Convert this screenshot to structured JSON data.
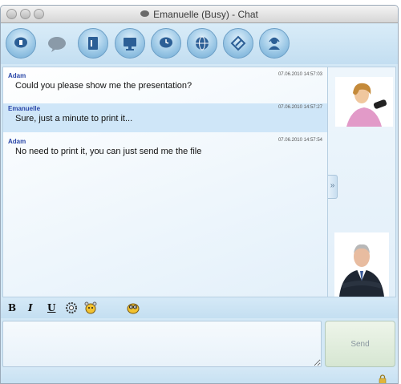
{
  "window": {
    "title": "Emanuelle (Busy) - Chat"
  },
  "toolbar": {
    "buttons": [
      {
        "icon": "chat-bubble-icon"
      },
      {
        "icon": "speech-bubble-icon"
      },
      {
        "icon": "file-send-icon"
      },
      {
        "icon": "screen-share-icon"
      },
      {
        "icon": "history-clock-icon"
      },
      {
        "icon": "globe-icon"
      },
      {
        "icon": "edit-pen-icon"
      },
      {
        "icon": "headset-user-icon"
      }
    ]
  },
  "messages": [
    {
      "sender": "Adam",
      "time": "07.06.2010 14:57:03",
      "text": "Could you please show me the presentation?",
      "highlighted": false
    },
    {
      "sender": "Emanuelle",
      "time": "07.06.2010 14:57:27",
      "text": "Sure, just a minute to print it...",
      "highlighted": true
    },
    {
      "sender": "Adam",
      "time": "07.06.2010 14:57:54",
      "text": "No need to print it, you can just send me the file",
      "highlighted": false
    }
  ],
  "side_panel": {
    "expand_label": "»",
    "contact_avatar": "woman-avatar",
    "user_avatar": "man-avatar"
  },
  "format_bar": {
    "bold_label": "B",
    "italic_label": "I",
    "underline_label": "U"
  },
  "input": {
    "value": ""
  },
  "send_label": "Send",
  "colors": {
    "accent": "#2a47a8",
    "highlight": "#cfe6f8",
    "background": "#d3e8f6"
  }
}
